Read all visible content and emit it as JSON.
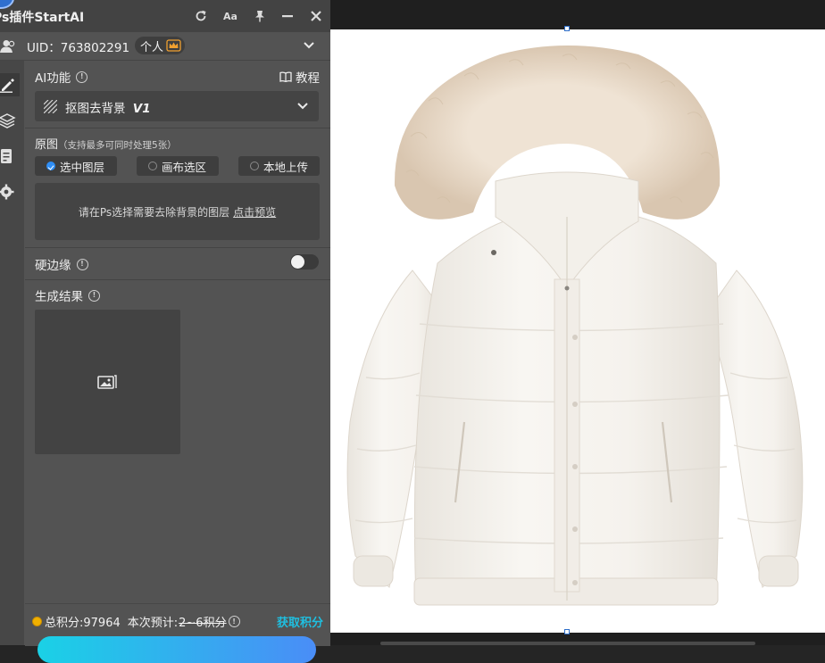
{
  "window": {
    "title": "Ps插件StartAI",
    "icons": [
      "refresh-icon",
      "font-size-icon",
      "pin-icon",
      "minimize-icon",
      "close-icon"
    ],
    "font_button_label": "Aa"
  },
  "user": {
    "uid_text": "UID：763802291",
    "plan_label": "个人",
    "icons": [
      "users-icon",
      "crown-icon",
      "chevron-down-icon"
    ]
  },
  "rail": {
    "icons": [
      "edit-icon",
      "layers-icon",
      "document-icon",
      "settings-icon"
    ],
    "active": "edit-icon"
  },
  "ai_function": {
    "label": "AI功能",
    "tutorial_label": "教程",
    "selected_function": "抠图去背景",
    "version_mark": "V1"
  },
  "source": {
    "label": "原图",
    "note": "（支持最多可同时处理5张）",
    "options": [
      {
        "label": "选中图层",
        "selected": true
      },
      {
        "label": "画布选区",
        "selected": false
      },
      {
        "label": "本地上传",
        "selected": false
      }
    ],
    "hint": "请在Ps选择需要去除背景的图层",
    "preview_link": "点击预览"
  },
  "hard_edge": {
    "label": "硬边缘",
    "enabled": false
  },
  "result": {
    "label": "生成结果",
    "placeholder_icon": "image-placeholder-icon"
  },
  "footer": {
    "points_label": "总积分:97964",
    "estimate_label": "本次预计:",
    "estimate_value": "2~6积分",
    "get_points_label": "获取积分"
  },
  "colors": {
    "panel_bg": "#535353",
    "accent_cyan": "#1fbfe0",
    "radio_on": "#2f8ef5",
    "crown": "#f0a030"
  }
}
